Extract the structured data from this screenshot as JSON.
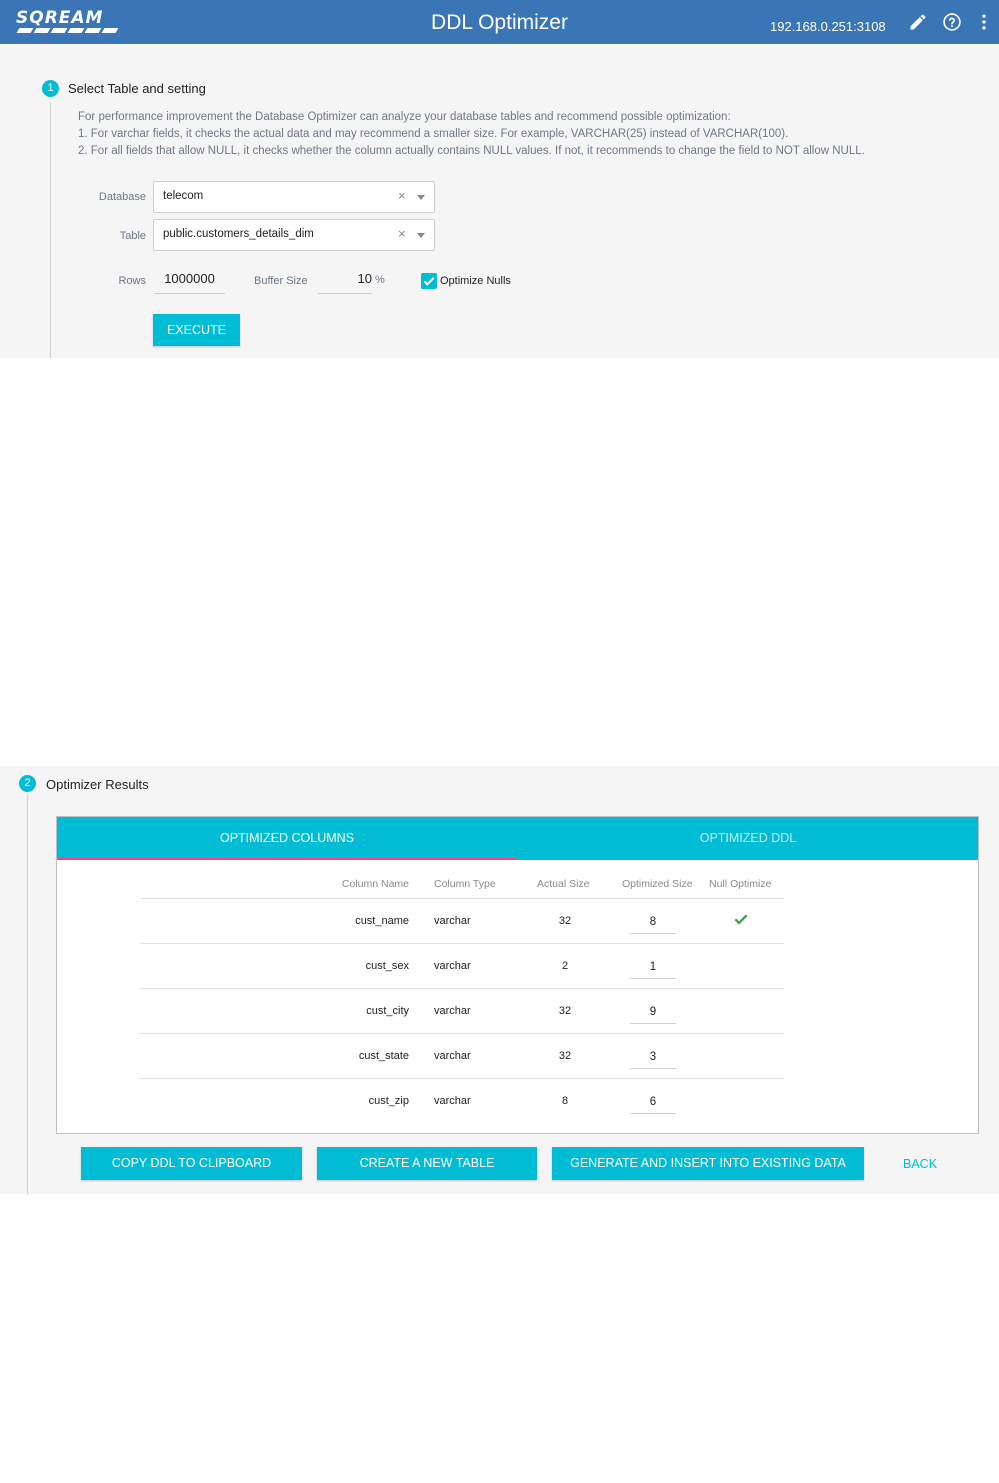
{
  "header": {
    "logo_text": "SQREAM",
    "title": "DDL Optimizer",
    "host": "192.168.0.251:3108",
    "icons": [
      "edit-icon",
      "help-icon",
      "more-vert-icon"
    ],
    "bg_color": "#3a75b5"
  },
  "step1": {
    "number": "1",
    "title": "Select Table and setting",
    "description": [
      "For performance improvement the Database Optimizer can analyze your database tables and recommend possible optimization:",
      "1. For varchar fields, it checks the actual data and may recommend a smaller size. For example, VARCHAR(25) instead of VARCHAR(100).",
      "2. For all fields that allow NULL, it checks whether the column actually contains NULL values. If not, it recommends to change the field to NOT allow NULL."
    ],
    "database_label": "Database",
    "database_value": "telecom",
    "table_label": "Table",
    "table_value": "public.customers_details_dim",
    "rows_label": "Rows",
    "rows_value": "1000000",
    "buffer_label": "Buffer Size",
    "buffer_value": "10",
    "buffer_unit": "%",
    "optimize_nulls_label": "Optimize Nulls",
    "optimize_nulls_checked": true,
    "execute_label": "EXECUTE"
  },
  "step2": {
    "number": "2",
    "title": "Optimizer Results",
    "tabs": [
      "OPTIMIZED COLUMNS",
      "OPTIMIZED DDL"
    ],
    "active_tab": 0,
    "columns": [
      "Column Name",
      "Column Type",
      "Actual Size",
      "Optimized Size",
      "Null Optimize"
    ],
    "rows": [
      {
        "name": "cust_name",
        "type": "varchar",
        "actual": "32",
        "optimized": "8",
        "null_opt": true
      },
      {
        "name": "cust_sex",
        "type": "varchar",
        "actual": "2",
        "optimized": "1",
        "null_opt": false
      },
      {
        "name": "cust_city",
        "type": "varchar",
        "actual": "32",
        "optimized": "9",
        "null_opt": false
      },
      {
        "name": "cust_state",
        "type": "varchar",
        "actual": "32",
        "optimized": "3",
        "null_opt": false
      },
      {
        "name": "cust_zip",
        "type": "varchar",
        "actual": "8",
        "optimized": "6",
        "null_opt": false
      }
    ],
    "buttons": {
      "copy": "COPY DDL TO CLIPBOARD",
      "create": "CREATE A NEW TABLE",
      "generate": "GENERATE AND INSERT INTO EXISTING DATA",
      "back": "BACK"
    }
  },
  "colors": {
    "accent": "#00bcd4",
    "tab_indicator": "#ff4081",
    "check": "#43a047"
  }
}
